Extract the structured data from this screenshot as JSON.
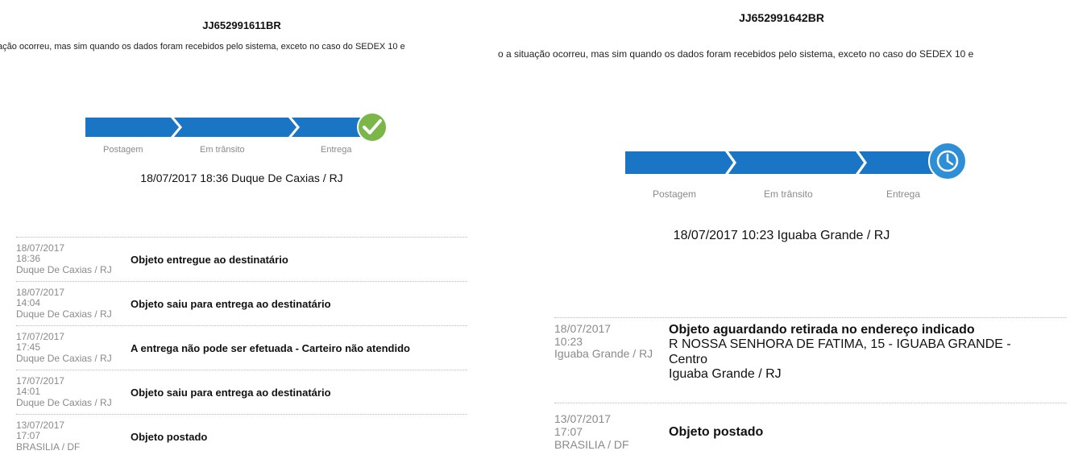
{
  "left": {
    "tracking_code": "JJ652991611BR",
    "notice_text": "ıação ocorreu, mas sim quando os dados foram recebidos pelo sistema, exceto no caso do SEDEX 10 e",
    "steps": [
      "Postagem",
      "Em trânsito",
      "Entrega"
    ],
    "status_icon": "check-icon",
    "status_color": "#7ab648",
    "bar_color": "#1a75c4",
    "status_line": "18/07/2017 18:36 Duque De Caxias / RJ",
    "events": [
      {
        "date": "18/07/2017",
        "time": "18:36",
        "place": "Duque De Caxias / RJ",
        "title": "Objeto entregue ao destinatário"
      },
      {
        "date": "18/07/2017",
        "time": "14:04",
        "place": "Duque De Caxias / RJ",
        "title": "Objeto saiu para entrega ao destinatário"
      },
      {
        "date": "17/07/2017",
        "time": "17:45",
        "place": "Duque De Caxias / RJ",
        "title": "A entrega não pode ser efetuada - Carteiro não atendido"
      },
      {
        "date": "17/07/2017",
        "time": "14:01",
        "place": "Duque De Caxias / RJ",
        "title": "Objeto saiu para entrega ao destinatário"
      },
      {
        "date": "13/07/2017",
        "time": "17:07",
        "place": "BRASILIA / DF",
        "title": "Objeto postado"
      }
    ]
  },
  "right": {
    "tracking_code": "JJ652991642BR",
    "notice_text": "o a situação ocorreu, mas sim quando os dados foram recebidos pelo sistema, exceto no caso do SEDEX 10 e",
    "steps": [
      "Postagem",
      "Em trânsito",
      "Entrega"
    ],
    "status_icon": "clock-icon",
    "status_color": "#2f8fd6",
    "bar_color": "#1a75c4",
    "status_line": "18/07/2017 10:23 Iguaba Grande / RJ",
    "events": [
      {
        "date": "18/07/2017",
        "time": "10:23",
        "place": "Iguaba Grande / RJ",
        "title": "Objeto aguardando retirada no endereço indicado",
        "detail_line1": "R NOSSA SENHORA DE FATIMA, 15 - IGUABA GRANDE -",
        "detail_line2": "Centro",
        "detail_line3": "Iguaba Grande / RJ"
      },
      {
        "date": "13/07/2017",
        "time": "17:07",
        "place": "BRASILIA / DF",
        "title": "Objeto postado"
      }
    ]
  }
}
